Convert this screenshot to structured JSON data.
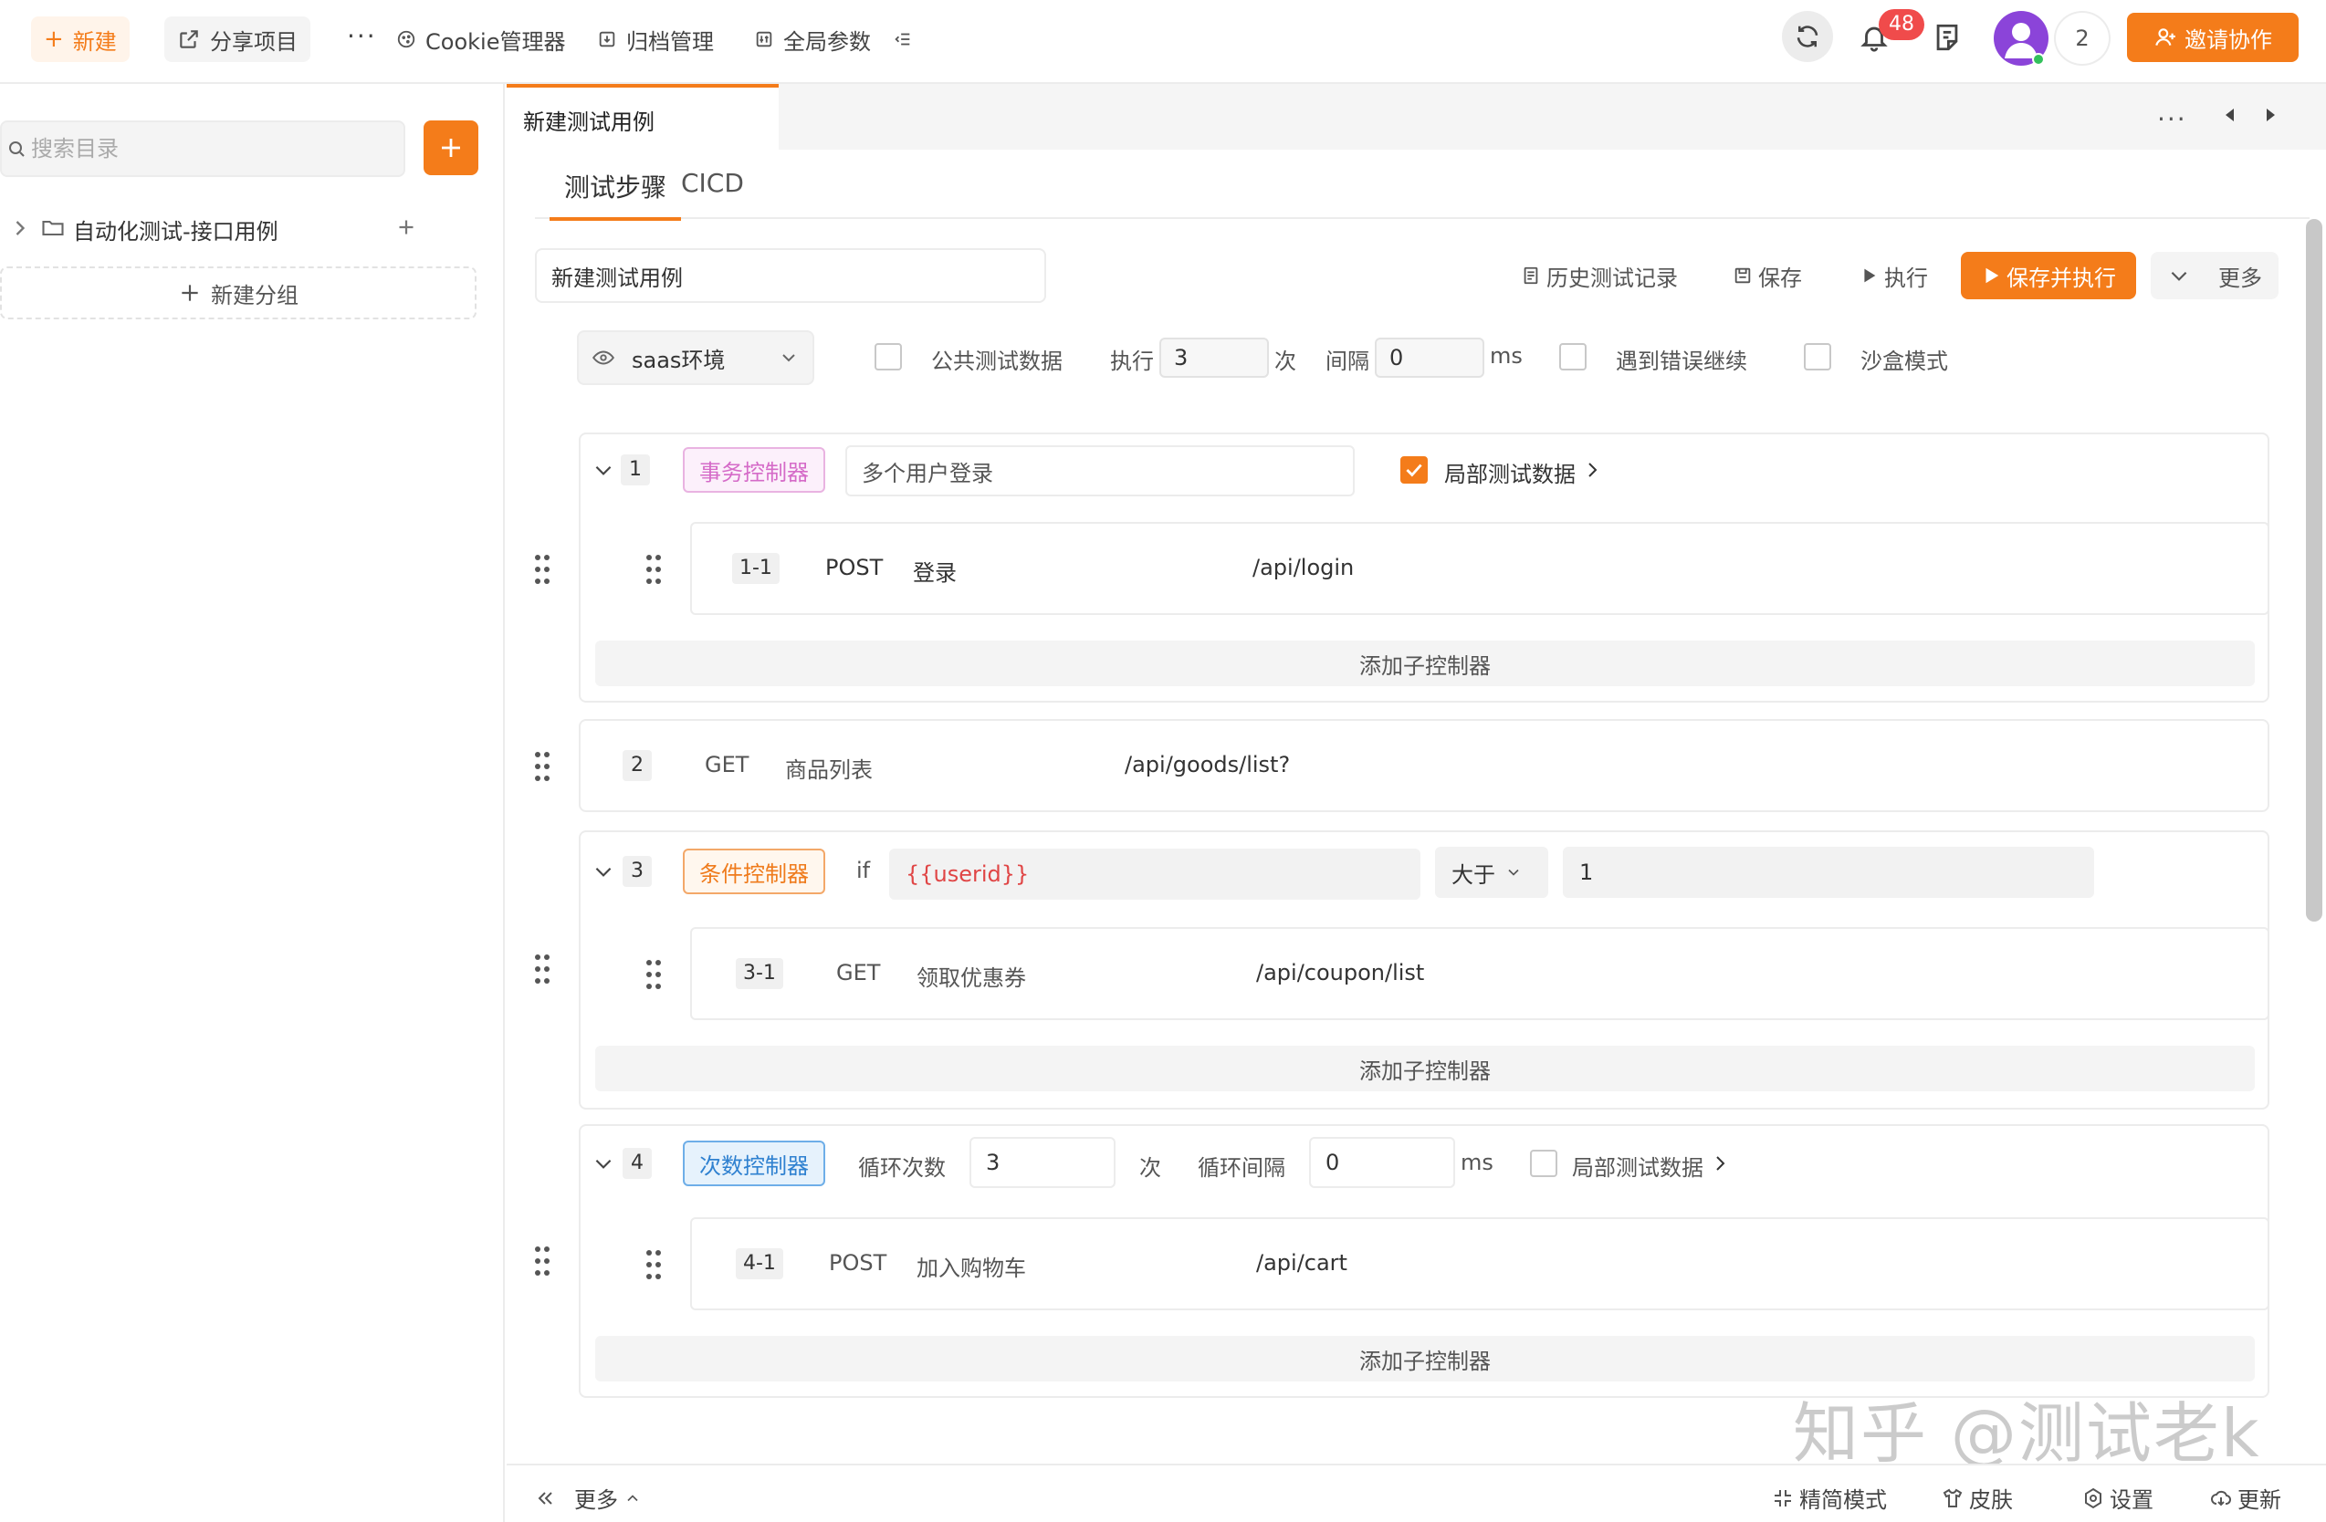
{
  "topbar": {
    "new_label": "新建",
    "share_label": "分享项目",
    "more_label": "···",
    "cookie_label": "Cookie管理器",
    "archive_label": "归档管理",
    "global_params_label": "全局参数",
    "notification_count": "48",
    "member_count": "2",
    "invite_label": "邀请协作"
  },
  "sidebar": {
    "search_placeholder": "搜索目录",
    "tree": [
      {
        "label": "自动化测试-接口用例"
      }
    ],
    "new_group_label": "新建分组"
  },
  "tabs": {
    "active_doc": "新建测试用例"
  },
  "subtabs": [
    "测试步骤",
    "CICD"
  ],
  "case": {
    "name": "新建测试用例",
    "history_label": "历史测试记录",
    "save_label": "保存",
    "run_label": "执行",
    "save_run_label": "保存并执行",
    "more_label": "更多"
  },
  "settings": {
    "env": "saas环境",
    "public_data_label": "公共测试数据",
    "exec_label": "执行",
    "exec_count": "3",
    "times_label": "次",
    "interval_label": "间隔",
    "interval_value": "0",
    "ms_label": "ms",
    "continue_on_error_label": "遇到错误继续",
    "sandbox_label": "沙盒模式"
  },
  "steps": [
    {
      "no": "1",
      "tag": "事务控制器",
      "name": "多个用户登录",
      "local_data_label": "局部测试数据",
      "local_data_checked": true,
      "children": [
        {
          "no": "1-1",
          "method": "POST",
          "name": "登录",
          "path": "/api/login"
        }
      ],
      "add_child_label": "添加子控制器"
    },
    {
      "no": "2",
      "method": "GET",
      "name": "商品列表",
      "path": "/api/goods/list?"
    },
    {
      "no": "3",
      "tag": "条件控制器",
      "if_label": "if",
      "variable": "{{userid}}",
      "operator": "大于",
      "compare_value": "1",
      "children": [
        {
          "no": "3-1",
          "method": "GET",
          "name": "领取优惠券",
          "path": "/api/coupon/list"
        }
      ],
      "add_child_label": "添加子控制器"
    },
    {
      "no": "4",
      "tag": "次数控制器",
      "loop_count_label": "循环次数",
      "loop_count": "3",
      "times_label": "次",
      "loop_interval_label": "循环间隔",
      "loop_interval": "0",
      "ms_label": "ms",
      "local_data_label": "局部测试数据",
      "local_data_checked": false,
      "children": [
        {
          "no": "4-1",
          "method": "POST",
          "name": "加入购物车",
          "path": "/api/cart"
        }
      ],
      "add_child_label": "添加子控制器"
    }
  ],
  "footer": {
    "more_label": "更多",
    "simple_mode_label": "精简模式",
    "skin_label": "皮肤",
    "settings_label": "设置",
    "update_label": "更新"
  },
  "watermark": "知乎 @测试老k",
  "colors": {
    "accent": "#f47c1a",
    "badge": "#f04b4b",
    "avatar": "#8b44d9",
    "variable": "#e04545"
  }
}
